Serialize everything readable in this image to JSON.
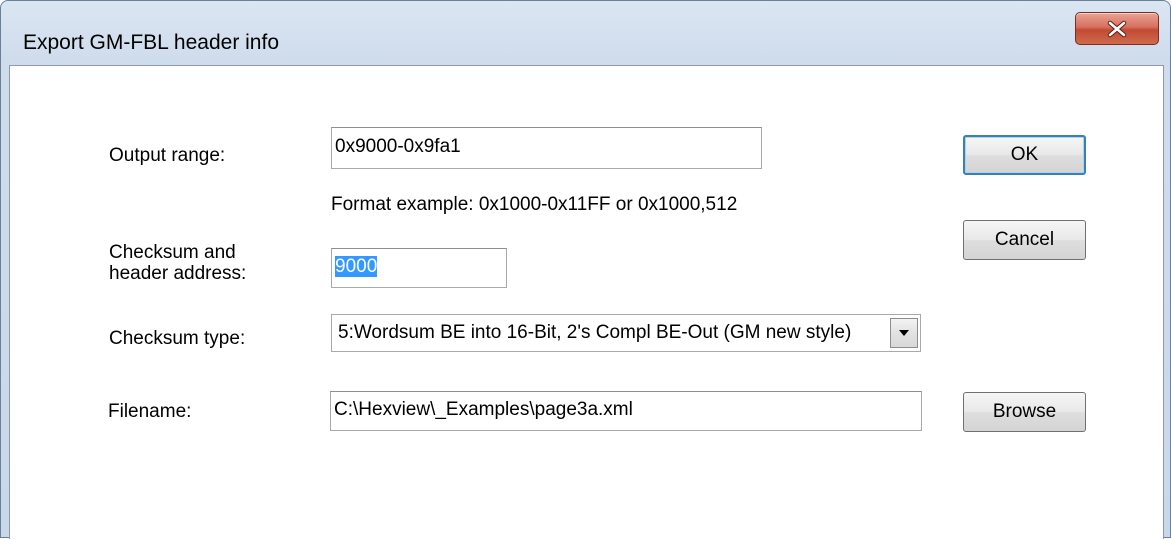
{
  "window": {
    "title": "Export GM-FBL header info",
    "close_glyph": "✕"
  },
  "form": {
    "output_range_label": "Output range:",
    "output_range_value": "0x9000-0x9fa1",
    "format_example": "Format example: 0x1000-0x11FF or 0x1000,512",
    "checksum_address_label_line1": "Checksum and",
    "checksum_address_label_line2": "header address:",
    "checksum_address_value": "9000",
    "checksum_type_label": "Checksum type:",
    "checksum_type_value": "5:Wordsum BE into 16-Bit, 2's Compl BE-Out (GM new style)",
    "filename_label": "Filename:",
    "filename_value": "C:\\Hexview\\_Examples\\page3a.xml"
  },
  "buttons": {
    "ok": "OK",
    "cancel": "Cancel",
    "browse": "Browse"
  },
  "icons": {
    "close": "close-icon",
    "dropdown": "chevron-down-icon"
  },
  "colors": {
    "close_button": "#c9543c",
    "selection": "#3399ff",
    "default_button_border": "#3c7fb1"
  }
}
